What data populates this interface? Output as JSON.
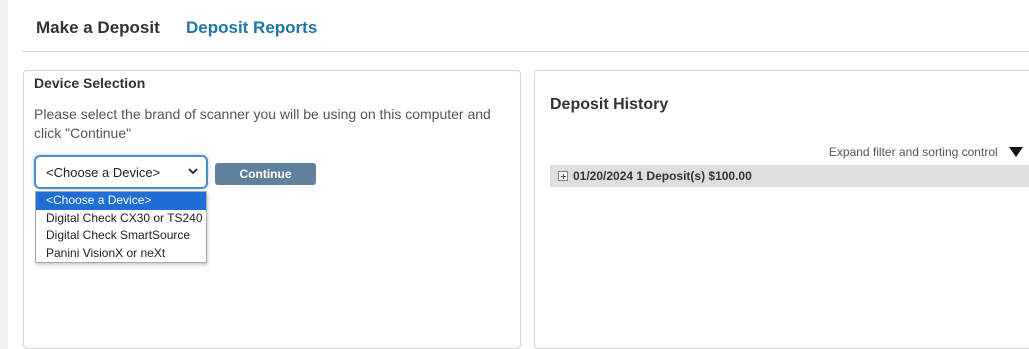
{
  "tabs": {
    "make_deposit": "Make a Deposit",
    "deposit_reports": "Deposit Reports"
  },
  "device_selection": {
    "title": "Device Selection",
    "instructions": "Please select the brand of scanner you will be using on this computer and click \"Continue\"",
    "select": {
      "value": "<Choose a Device>",
      "options": [
        "<Choose a Device>",
        "Digital Check CX30 or TS240",
        "Digital Check SmartSource",
        "Panini VisionX or neXt"
      ],
      "highlighted_index": 0
    },
    "continue_label": "Continue"
  },
  "deposit_history": {
    "title": "Deposit History",
    "filter_label": "Expand filter and sorting control",
    "rows": [
      {
        "label": "01/20/2024 1 Deposit(s) $100.00"
      }
    ]
  },
  "colors": {
    "accent_link": "#1d77a8",
    "button_bg": "#61809b",
    "focus_ring": "#4a8fd0",
    "selected_option": "#1e6ed6",
    "row_bg": "#dedede"
  },
  "icons": {
    "select_chevron": "chevron-down-icon",
    "filter_toggle": "triangle-down-icon",
    "row_expand": "plus-box-icon"
  }
}
